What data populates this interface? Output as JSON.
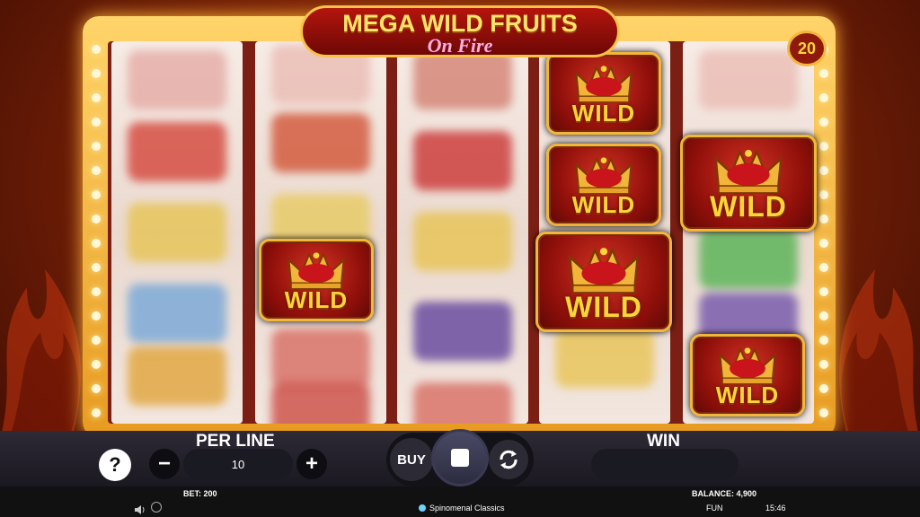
{
  "game": {
    "title_line1": "MEGA WILD FRUITS",
    "title_line2": "On Fire",
    "lines_badge": "20",
    "wild_label": "WILD"
  },
  "controls": {
    "help_label": "?",
    "per_line_label": "PER LINE",
    "per_line_value": "10",
    "minus_label": "−",
    "plus_label": "+",
    "buy_label": "BUY",
    "win_label": "WIN",
    "win_value": ""
  },
  "status": {
    "bet": "BET: 200",
    "balance": "BALANCE: 4,900",
    "provider": "Spinomenal Classics",
    "mode": "FUN",
    "time": "15:46"
  },
  "colors": {
    "accent_gold": "#f3b53a",
    "wild_red": "#b3150d",
    "panel_dark": "#1a1820"
  },
  "icons": [
    "help-icon",
    "minus-icon",
    "plus-icon",
    "stop-icon",
    "autoplay-icon",
    "sound-icon",
    "turbo-icon",
    "provider-icon",
    "crown-icon"
  ]
}
